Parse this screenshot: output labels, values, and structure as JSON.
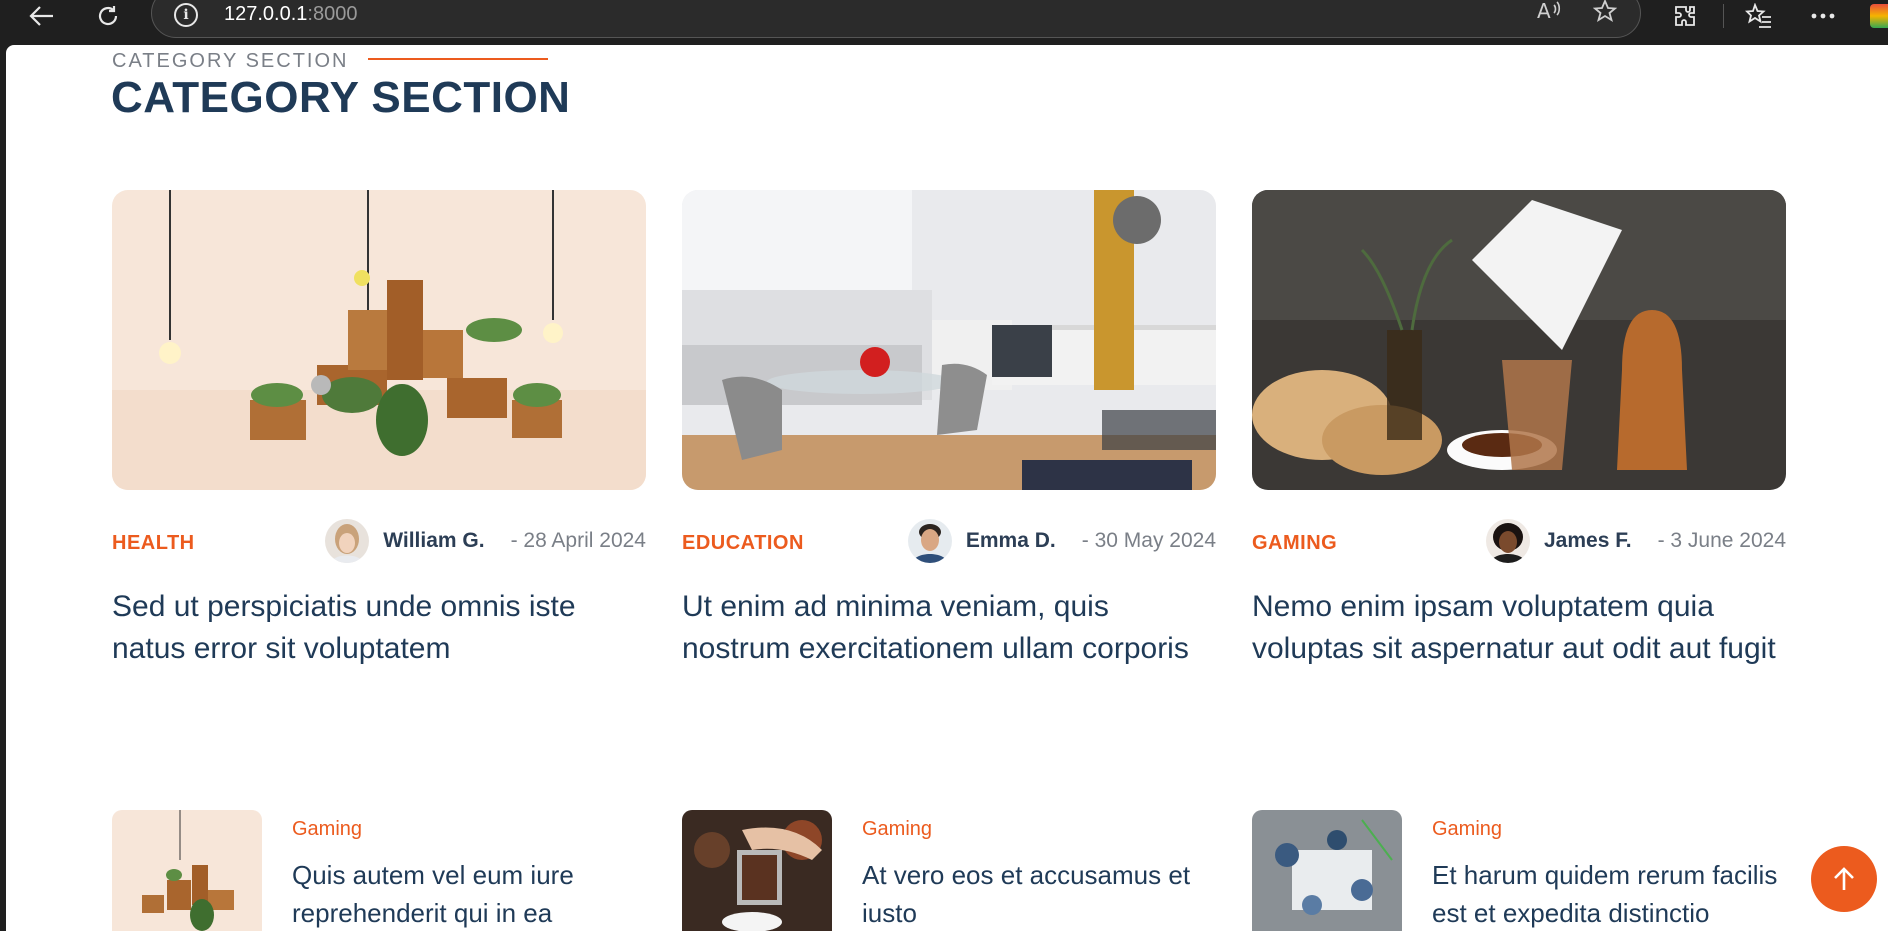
{
  "browser": {
    "url_host": "127.0.0.1",
    "url_port": ":8000",
    "icons": [
      "back-icon",
      "refresh-icon",
      "info-icon",
      "read-aloud-icon",
      "favorite-star-icon",
      "extensions-icon",
      "favorites-icon",
      "more-icon"
    ]
  },
  "section": {
    "eyebrow": "CATEGORY SECTION",
    "title": "CATEGORY SECTION"
  },
  "cards": [
    {
      "category": "HEALTH",
      "author": "William G.",
      "date": "-  28 April 2024",
      "title": "Sed ut perspiciatis unde omnis iste natus error sit voluptatem"
    },
    {
      "category": "EDUCATION",
      "author": "Emma D.",
      "date": "-  30 May 2024",
      "title": "Ut enim ad minima veniam, quis nostrum exercitationem ullam corporis"
    },
    {
      "category": "GAMING",
      "author": "James F.",
      "date": "-  3 June 2024",
      "title": "Nemo enim ipsam voluptatem quia voluptas sit aspernatur aut odit aut fugit"
    }
  ],
  "mini_posts": [
    {
      "category": "Gaming",
      "title": "Quis autem vel eum iure reprehenderit qui in ea"
    },
    {
      "category": "Gaming",
      "title": "At vero eos et accusamus et iusto"
    },
    {
      "category": "Gaming",
      "title": "Et harum quidem rerum facilis est et expedita distinctio"
    }
  ],
  "colors": {
    "accent": "#ec5b1e",
    "heading": "#1f3a57"
  }
}
